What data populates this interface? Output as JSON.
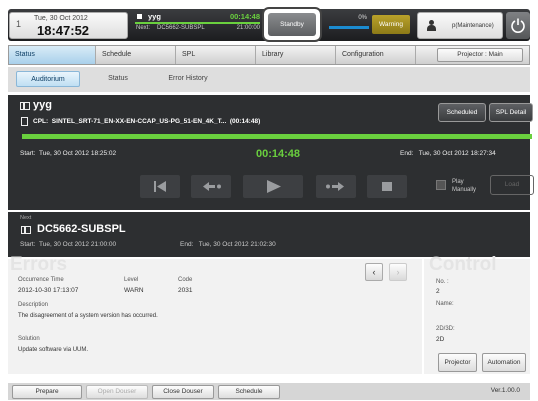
{
  "header": {
    "index": "1",
    "date": "Tue, 30 Oct 2012",
    "time": "18:47:52",
    "now_title": "yyg",
    "now_elapsed": "00:14:48",
    "next_label": "Next:",
    "next_title": "DC5662-SUBSPL",
    "next_time": "21:00:00",
    "standby_label": "Standby",
    "ingest_percent": "0%",
    "warning_label": "Warning",
    "user_label": "p(Maintenance)",
    "ingest_progress": 0
  },
  "tabs": {
    "items": [
      "Status",
      "Schedule",
      "SPL",
      "Library",
      "Configuration"
    ],
    "projector_main": "Projector : Main"
  },
  "subtabs": {
    "items": [
      "Auditorium",
      "Status",
      "Error History"
    ]
  },
  "playback": {
    "title": "yyg",
    "cpl_label": "CPL:",
    "cpl_name": "SINTEL_SRT-71_EN-XX-EN-CCAP_US-PG_51-EN_4K_T...",
    "cpl_duration": "(00:14:48)",
    "scheduled_label": "Scheduled",
    "spl_detail_label": "SPL Detail",
    "start_label": "Start:",
    "start_time": "Tue, 30 Oct 2012 18:25:02",
    "elapsed": "00:14:48",
    "end_label": "End:",
    "end_time": "Tue, 30 Oct 2012 18:27:34",
    "progress": 1.0,
    "play_manually_line1": "Play",
    "play_manually_line2": "Manually",
    "load_label": "Load"
  },
  "next": {
    "label": "Next",
    "title": "DC5662-SUBSPL",
    "start_label": "Start:",
    "start_time": "Tue, 30 Oct 2012 21:00:00",
    "end_label": "End:",
    "end_time": "Tue, 30 Oct 2012 21:02:30"
  },
  "errors": {
    "heading": "Errors",
    "columns": [
      "Occurrence Time",
      "Level",
      "Code"
    ],
    "occurrence_time": "2012-10-30 17:13:07",
    "level": "WARN",
    "code": "2031",
    "description_label": "Description",
    "description": "The disagreement of a system version has occurred.",
    "solution_label": "Solution",
    "solution": "Update software via UUM.",
    "prev": "‹",
    "next": "›"
  },
  "control": {
    "heading": "Control",
    "no_label": "No. :",
    "no_value": "2",
    "name_label": "Name:",
    "mode_label": "2D/3D:",
    "mode_value": "2D",
    "projector_label": "Projector",
    "automation_label": "Automation"
  },
  "footer": {
    "prepare": "Prepare",
    "open_douser": "Open Douser",
    "close_douser": "Close Douser",
    "schedule": "Schedule",
    "version": "Ver.1.00.0"
  },
  "colors": {
    "accent_green": "#6ad03e",
    "dark_panel": "#2d2f31",
    "tab_active": "#a9d0eb",
    "warning": "#b9a12a"
  }
}
